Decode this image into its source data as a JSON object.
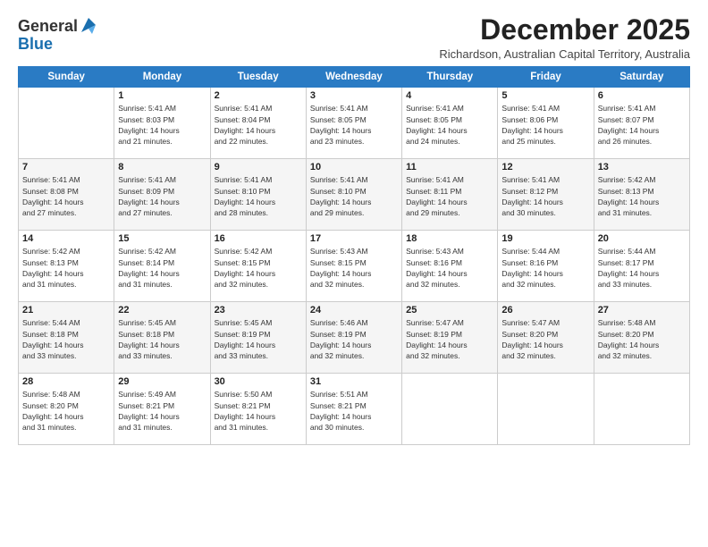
{
  "logo": {
    "general": "General",
    "blue": "Blue"
  },
  "header": {
    "month": "December 2025",
    "subtitle": "Richardson, Australian Capital Territory, Australia"
  },
  "weekdays": [
    "Sunday",
    "Monday",
    "Tuesday",
    "Wednesday",
    "Thursday",
    "Friday",
    "Saturday"
  ],
  "weeks": [
    [
      {
        "day": "",
        "sunrise": "",
        "sunset": "",
        "daylight": ""
      },
      {
        "day": "1",
        "sunrise": "Sunrise: 5:41 AM",
        "sunset": "Sunset: 8:03 PM",
        "daylight": "Daylight: 14 hours and 21 minutes."
      },
      {
        "day": "2",
        "sunrise": "Sunrise: 5:41 AM",
        "sunset": "Sunset: 8:04 PM",
        "daylight": "Daylight: 14 hours and 22 minutes."
      },
      {
        "day": "3",
        "sunrise": "Sunrise: 5:41 AM",
        "sunset": "Sunset: 8:05 PM",
        "daylight": "Daylight: 14 hours and 23 minutes."
      },
      {
        "day": "4",
        "sunrise": "Sunrise: 5:41 AM",
        "sunset": "Sunset: 8:05 PM",
        "daylight": "Daylight: 14 hours and 24 minutes."
      },
      {
        "day": "5",
        "sunrise": "Sunrise: 5:41 AM",
        "sunset": "Sunset: 8:06 PM",
        "daylight": "Daylight: 14 hours and 25 minutes."
      },
      {
        "day": "6",
        "sunrise": "Sunrise: 5:41 AM",
        "sunset": "Sunset: 8:07 PM",
        "daylight": "Daylight: 14 hours and 26 minutes."
      }
    ],
    [
      {
        "day": "7",
        "sunrise": "Sunrise: 5:41 AM",
        "sunset": "Sunset: 8:08 PM",
        "daylight": "Daylight: 14 hours and 27 minutes."
      },
      {
        "day": "8",
        "sunrise": "Sunrise: 5:41 AM",
        "sunset": "Sunset: 8:09 PM",
        "daylight": "Daylight: 14 hours and 27 minutes."
      },
      {
        "day": "9",
        "sunrise": "Sunrise: 5:41 AM",
        "sunset": "Sunset: 8:10 PM",
        "daylight": "Daylight: 14 hours and 28 minutes."
      },
      {
        "day": "10",
        "sunrise": "Sunrise: 5:41 AM",
        "sunset": "Sunset: 8:10 PM",
        "daylight": "Daylight: 14 hours and 29 minutes."
      },
      {
        "day": "11",
        "sunrise": "Sunrise: 5:41 AM",
        "sunset": "Sunset: 8:11 PM",
        "daylight": "Daylight: 14 hours and 29 minutes."
      },
      {
        "day": "12",
        "sunrise": "Sunrise: 5:41 AM",
        "sunset": "Sunset: 8:12 PM",
        "daylight": "Daylight: 14 hours and 30 minutes."
      },
      {
        "day": "13",
        "sunrise": "Sunrise: 5:42 AM",
        "sunset": "Sunset: 8:13 PM",
        "daylight": "Daylight: 14 hours and 31 minutes."
      }
    ],
    [
      {
        "day": "14",
        "sunrise": "Sunrise: 5:42 AM",
        "sunset": "Sunset: 8:13 PM",
        "daylight": "Daylight: 14 hours and 31 minutes."
      },
      {
        "day": "15",
        "sunrise": "Sunrise: 5:42 AM",
        "sunset": "Sunset: 8:14 PM",
        "daylight": "Daylight: 14 hours and 31 minutes."
      },
      {
        "day": "16",
        "sunrise": "Sunrise: 5:42 AM",
        "sunset": "Sunset: 8:15 PM",
        "daylight": "Daylight: 14 hours and 32 minutes."
      },
      {
        "day": "17",
        "sunrise": "Sunrise: 5:43 AM",
        "sunset": "Sunset: 8:15 PM",
        "daylight": "Daylight: 14 hours and 32 minutes."
      },
      {
        "day": "18",
        "sunrise": "Sunrise: 5:43 AM",
        "sunset": "Sunset: 8:16 PM",
        "daylight": "Daylight: 14 hours and 32 minutes."
      },
      {
        "day": "19",
        "sunrise": "Sunrise: 5:44 AM",
        "sunset": "Sunset: 8:16 PM",
        "daylight": "Daylight: 14 hours and 32 minutes."
      },
      {
        "day": "20",
        "sunrise": "Sunrise: 5:44 AM",
        "sunset": "Sunset: 8:17 PM",
        "daylight": "Daylight: 14 hours and 33 minutes."
      }
    ],
    [
      {
        "day": "21",
        "sunrise": "Sunrise: 5:44 AM",
        "sunset": "Sunset: 8:18 PM",
        "daylight": "Daylight: 14 hours and 33 minutes."
      },
      {
        "day": "22",
        "sunrise": "Sunrise: 5:45 AM",
        "sunset": "Sunset: 8:18 PM",
        "daylight": "Daylight: 14 hours and 33 minutes."
      },
      {
        "day": "23",
        "sunrise": "Sunrise: 5:45 AM",
        "sunset": "Sunset: 8:19 PM",
        "daylight": "Daylight: 14 hours and 33 minutes."
      },
      {
        "day": "24",
        "sunrise": "Sunrise: 5:46 AM",
        "sunset": "Sunset: 8:19 PM",
        "daylight": "Daylight: 14 hours and 32 minutes."
      },
      {
        "day": "25",
        "sunrise": "Sunrise: 5:47 AM",
        "sunset": "Sunset: 8:19 PM",
        "daylight": "Daylight: 14 hours and 32 minutes."
      },
      {
        "day": "26",
        "sunrise": "Sunrise: 5:47 AM",
        "sunset": "Sunset: 8:20 PM",
        "daylight": "Daylight: 14 hours and 32 minutes."
      },
      {
        "day": "27",
        "sunrise": "Sunrise: 5:48 AM",
        "sunset": "Sunset: 8:20 PM",
        "daylight": "Daylight: 14 hours and 32 minutes."
      }
    ],
    [
      {
        "day": "28",
        "sunrise": "Sunrise: 5:48 AM",
        "sunset": "Sunset: 8:20 PM",
        "daylight": "Daylight: 14 hours and 31 minutes."
      },
      {
        "day": "29",
        "sunrise": "Sunrise: 5:49 AM",
        "sunset": "Sunset: 8:21 PM",
        "daylight": "Daylight: 14 hours and 31 minutes."
      },
      {
        "day": "30",
        "sunrise": "Sunrise: 5:50 AM",
        "sunset": "Sunset: 8:21 PM",
        "daylight": "Daylight: 14 hours and 31 minutes."
      },
      {
        "day": "31",
        "sunrise": "Sunrise: 5:51 AM",
        "sunset": "Sunset: 8:21 PM",
        "daylight": "Daylight: 14 hours and 30 minutes."
      },
      {
        "day": "",
        "sunrise": "",
        "sunset": "",
        "daylight": ""
      },
      {
        "day": "",
        "sunrise": "",
        "sunset": "",
        "daylight": ""
      },
      {
        "day": "",
        "sunrise": "",
        "sunset": "",
        "daylight": ""
      }
    ]
  ]
}
